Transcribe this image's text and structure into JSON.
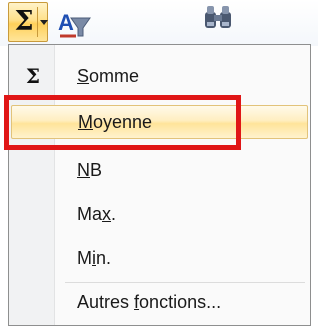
{
  "toolbar": {
    "sum_button": {
      "icon": "sigma-icon",
      "glyph": "Σ"
    },
    "sort_filter": {
      "icon": "sort-filter-icon"
    },
    "find_select": {
      "icon": "find-binoculars-icon"
    }
  },
  "menu": {
    "items": [
      {
        "label": "Somme",
        "access_key": "S",
        "rest": "omme",
        "icon": "Σ",
        "highlighted": false
      },
      {
        "label": "Moyenne",
        "access_key": "M",
        "rest": "oyenne",
        "highlighted": true
      },
      {
        "label": "NB",
        "access_key": "N",
        "rest": "B",
        "highlighted": false
      },
      {
        "label": "Max.",
        "before": "Ma",
        "access_key": "x",
        "rest": ".",
        "highlighted": false
      },
      {
        "label": "Min.",
        "before": "M",
        "access_key": "i",
        "rest": "n.",
        "highlighted": false
      },
      {
        "label": "Autres fonctions...",
        "before": "Autres ",
        "access_key": "f",
        "rest": "onctions...",
        "highlighted": false
      }
    ]
  },
  "colors": {
    "highlight": "#ffe49a",
    "annotation": "#e01616",
    "button_hover": "#ffd05a"
  }
}
